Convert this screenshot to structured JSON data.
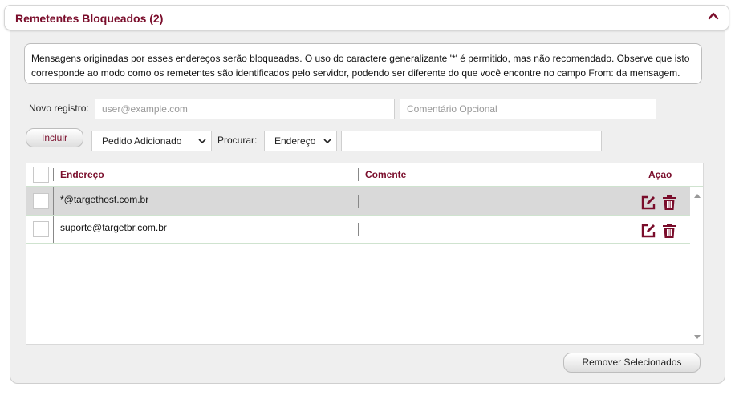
{
  "header": {
    "title": "Remetentes Bloqueados (2)",
    "collapse_icon": "chevron-up-icon"
  },
  "info": {
    "text": "Mensagens originadas por esses endereços serão bloqueadas. O uso do caractere generalizante '*' é permitido, mas não recomendado. Observe que isto corresponde ao modo como os remetentes são identificados pelo servidor, podendo ser diferente do que você encontre no campo From: da mensagem."
  },
  "form": {
    "new_label": "Novo registro:",
    "email_placeholder": "user@example.com",
    "comment_placeholder": "Comentário Opcional",
    "include_label": "Incluir",
    "order_value": "Pedido Adicionado",
    "search_label": "Procurar:",
    "search_field_value": "Endereço",
    "search_value": ""
  },
  "table": {
    "columns": [
      "Endereço",
      "Comente",
      "Açao"
    ],
    "rows": [
      {
        "address": "*@targethost.com.br",
        "comment": "",
        "selected_highlight": true
      },
      {
        "address": "suporte@targetbr.com.br",
        "comment": "",
        "selected_highlight": false
      }
    ],
    "edit_icon": "edit-icon",
    "delete_icon": "trash-icon"
  },
  "footer": {
    "remove_label": "Remover Selecionados"
  },
  "colors": {
    "accent": "#7a0d2b",
    "row_highlight": "#d9d9d9",
    "panel_bg": "#efefef"
  }
}
